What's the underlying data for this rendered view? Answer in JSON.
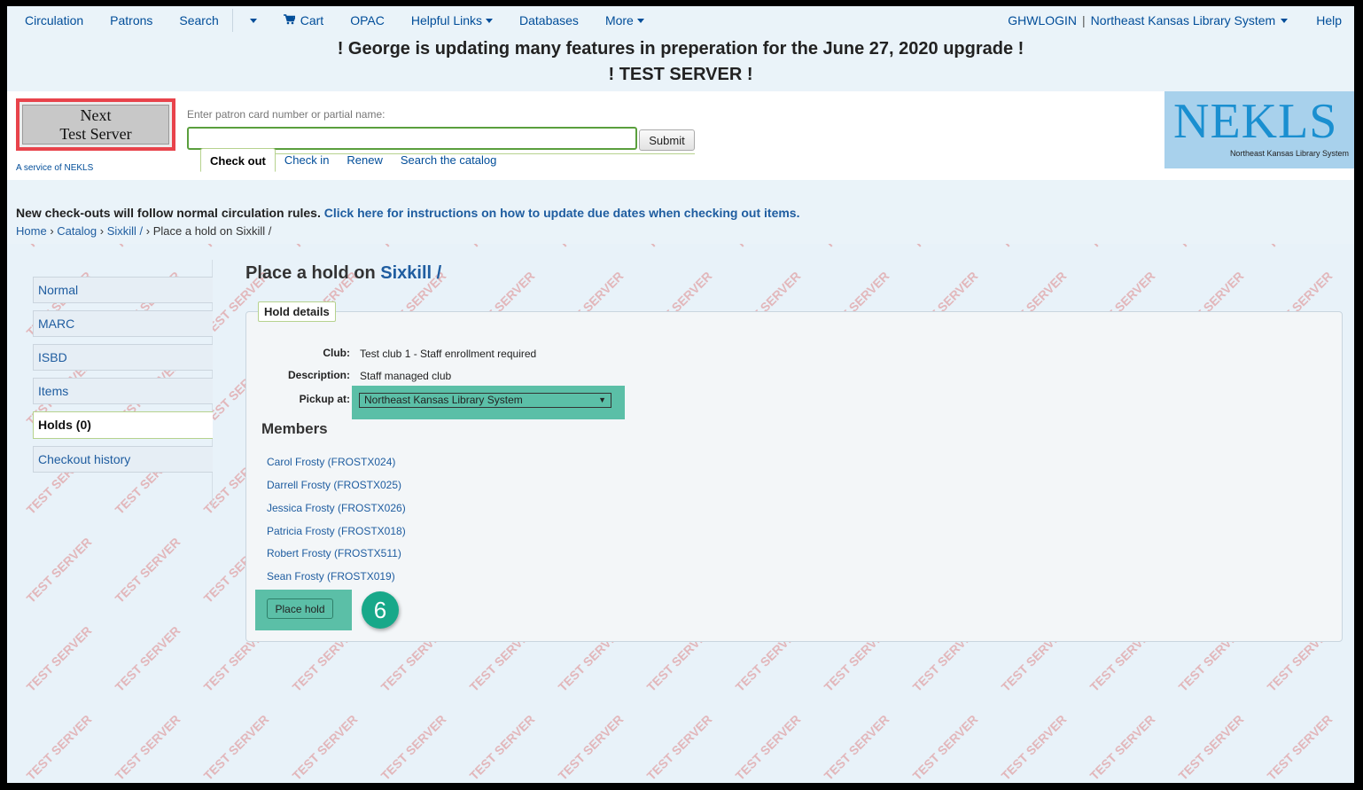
{
  "nav": {
    "items": [
      {
        "label": "Circulation"
      },
      {
        "label": "Patrons"
      },
      {
        "label": "Search"
      }
    ],
    "cart": "Cart",
    "opac": "OPAC",
    "helpful_links": "Helpful Links",
    "databases": "Databases",
    "more": "More",
    "user": "GHWLOGIN",
    "pipe": "|",
    "library": "Northeast Kansas Library System",
    "help": "Help"
  },
  "banner": {
    "line1": "! George is updating many features in preperation for the June 27, 2020 upgrade !",
    "line2": "! TEST SERVER !"
  },
  "header": {
    "next_line1": "Next",
    "next_line2": "Test Server",
    "service": "A service of NEKLS",
    "patron_label": "Enter patron card number or partial name:",
    "patron_value": "",
    "submit": "Submit",
    "tabs": [
      "Check out",
      "Check in",
      "Renew",
      "Search the catalog"
    ],
    "logo_big": "NEKLS",
    "logo_small": "Northeast Kansas Library System"
  },
  "notice": {
    "text": "New check-outs will follow normal circulation rules. ",
    "link": "Click here for instructions on how to update due dates when checking out items."
  },
  "breadcrumb": {
    "home": "Home",
    "catalog": "Catalog",
    "record": "Sixkill /",
    "sep": "›",
    "current": "Place a hold on Sixkill /"
  },
  "left_menu": [
    "Normal",
    "MARC",
    "ISBD",
    "Items",
    "Holds (0)",
    "Checkout history"
  ],
  "main": {
    "title_prefix": "Place a hold on ",
    "title_link": "Sixkill /",
    "legend": "Hold details",
    "club_label": "Club:",
    "club_value": "Test club 1 - Staff enrollment required",
    "desc_label": "Description:",
    "desc_value": "Staff managed club",
    "pickup_label": "Pickup at:",
    "pickup_value": "Northeast Kansas Library System",
    "members_heading": "Members",
    "members": [
      "Carol Frosty (FROSTX024)",
      "Darrell Frosty (FROSTX025)",
      "Jessica Frosty (FROSTX026)",
      "Patricia Frosty (FROSTX018)",
      "Robert Frosty (FROSTX511)",
      "Sean Frosty (FROSTX019)"
    ],
    "place_hold": "Place hold",
    "step": "6"
  },
  "watermark_text": "TEST SERVER",
  "colors": {
    "accent": "#1f5da0",
    "highlight": "#5bbfa7",
    "step_badge": "#18a889",
    "red_border": "#e8434b"
  }
}
